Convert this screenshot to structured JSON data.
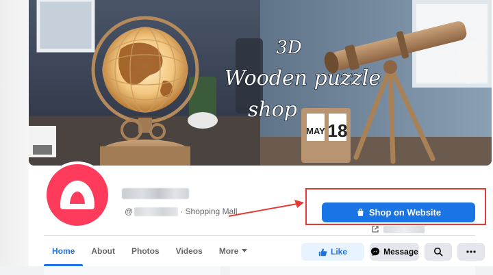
{
  "cover": {
    "headline_line1": "3D",
    "headline_line2": "Wooden puzzle",
    "headline_line3": "shop",
    "calendar_month": "MAY",
    "calendar_day": "18"
  },
  "profile": {
    "handle_prefix": "@",
    "category": "· Shopping Mall"
  },
  "cta": {
    "shop_label": "Shop on Website"
  },
  "tabs": [
    {
      "label": "Home",
      "active": true
    },
    {
      "label": "About",
      "active": false
    },
    {
      "label": "Photos",
      "active": false
    },
    {
      "label": "Videos",
      "active": false
    },
    {
      "label": "More",
      "active": false
    }
  ],
  "actions": {
    "like_label": "Like",
    "message_label": "Message"
  },
  "colors": {
    "brand_blue": "#1b74e4",
    "avatar_red": "#ff3b5c",
    "annotation_red": "#e53935"
  },
  "icons": {
    "shop": "shopping-bag-icon",
    "link": "external-link-icon",
    "like": "thumbs-up-icon",
    "message": "messenger-icon",
    "search": "search-icon",
    "more": "ellipsis-icon",
    "dropdown": "caret-down-icon"
  }
}
